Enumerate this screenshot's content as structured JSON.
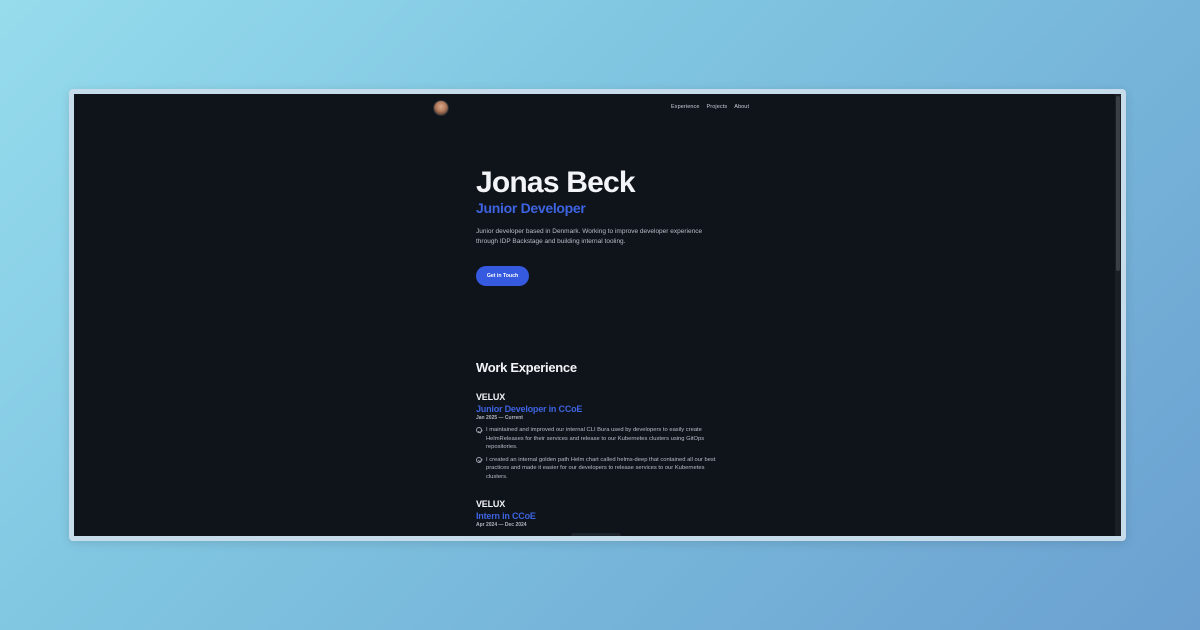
{
  "nav": {
    "items": [
      "Experience",
      "Projects",
      "About"
    ]
  },
  "hero": {
    "name": "Jonas Beck",
    "role": "Junior Developer",
    "bio": "Junior developer based in Denmark. Working to improve developer experience through IDP Backstage and building internal tooling.",
    "cta_label": "Get in Touch"
  },
  "work": {
    "title": "Work Experience",
    "jobs": [
      {
        "company": "VELUX",
        "title": "Junior Developer in CCoE",
        "dates": "Jan 2025 — Current",
        "bullets": [
          "I maintained and improved our internal CLI Bura used by developers to easily create HelmReleases for their services and release to our Kubernetes clusters using GitOps repositories.",
          "I created an internal golden path Helm chart called helms-deep that contained all our best practices and made it easier for our developers to release services to our Kubernetes clusters."
        ]
      },
      {
        "company": "VELUX",
        "title": "Intern in CCoE",
        "dates": "Apr 2024 — Dec 2024",
        "bullets": []
      }
    ]
  },
  "colors": {
    "accent": "#3d63e0",
    "background": "#0f141b",
    "button": "#3559df"
  }
}
